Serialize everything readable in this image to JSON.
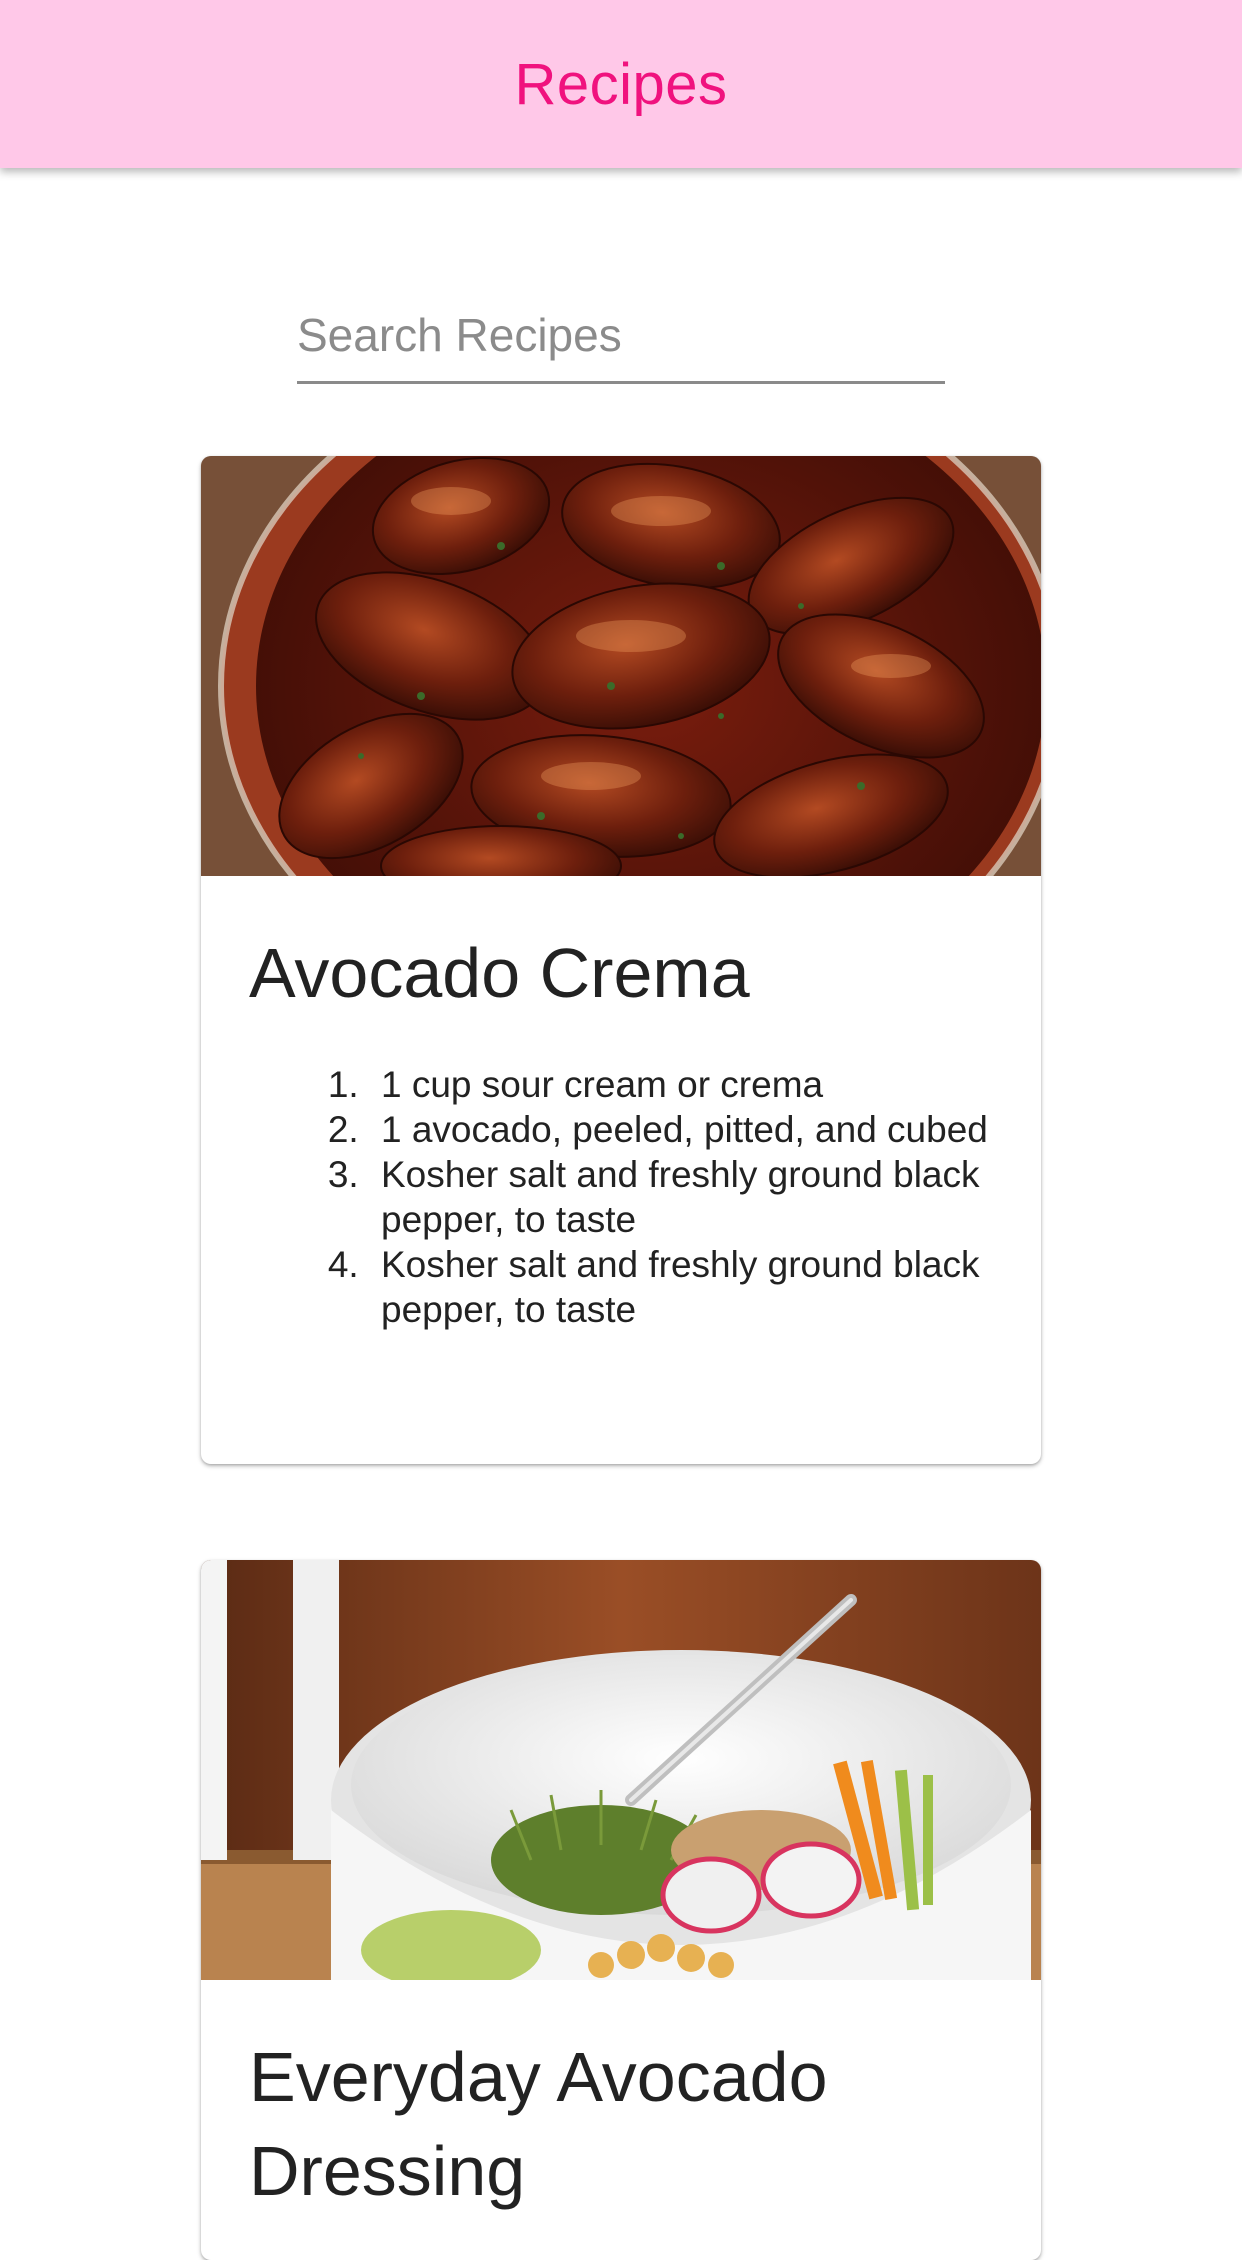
{
  "app_bar": {
    "title": "Recipes"
  },
  "search": {
    "placeholder": "Search Recipes",
    "value": ""
  },
  "recipes": [
    {
      "title": "Avocado Crema",
      "image": "bbq-chicken-wings-photo",
      "ingredients": [
        "1 cup sour cream or crema",
        "1 avocado, peeled, pitted, and cubed",
        "Kosher salt and freshly ground black pepper, to taste",
        "Kosher salt and freshly ground black pepper, to taste"
      ]
    },
    {
      "title": "Everyday Avocado Dressing",
      "image": "grain-bowl-with-avocado-dressing-photo",
      "ingredients": []
    }
  ],
  "colors": {
    "app_bar_bg": "#ffc8e8",
    "accent": "#f0127e"
  }
}
